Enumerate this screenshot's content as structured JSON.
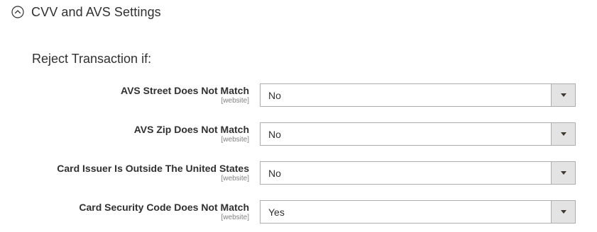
{
  "section": {
    "title": "CVV and AVS Settings",
    "icon": "chevron-up-circle-icon"
  },
  "group": {
    "title": "Reject Transaction if:"
  },
  "fields": [
    {
      "label": "AVS Street Does Not Match",
      "scope": "[website]",
      "value": "No"
    },
    {
      "label": "AVS Zip Does Not Match",
      "scope": "[website]",
      "value": "No"
    },
    {
      "label": "Card Issuer Is Outside The United States",
      "scope": "[website]",
      "value": "No"
    },
    {
      "label": "Card Security Code Does Not Match",
      "scope": "[website]",
      "value": "Yes"
    }
  ],
  "colors": {
    "text": "#303030",
    "scope": "#808080",
    "border": "#adadad",
    "arrow_bg": "#e3e3e3"
  }
}
